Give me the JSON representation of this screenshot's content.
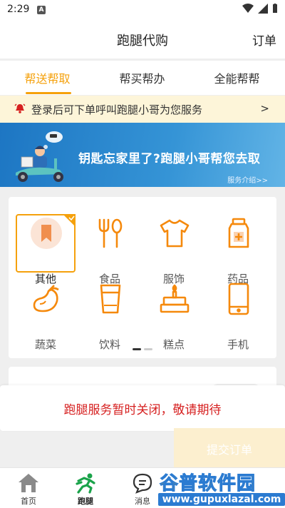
{
  "statusbar": {
    "time": "2:29",
    "notif_letter": "A"
  },
  "appbar": {
    "title": "跑腿代购",
    "orders_label": "订单"
  },
  "tabs": [
    {
      "label": "帮送帮取",
      "active": true
    },
    {
      "label": "帮买帮办",
      "active": false
    },
    {
      "label": "全能帮帮",
      "active": false
    }
  ],
  "notice": {
    "text": "登录后可下单呼叫跑腿小哥为您服务",
    "arrow": ">"
  },
  "banner": {
    "slogan": "钥匙忘家里了?跑腿小哥帮您去取",
    "intro_link": "服务介绍>>"
  },
  "categories": [
    {
      "label": "其他",
      "icon": "bookmark-icon",
      "selected": true
    },
    {
      "label": "食品",
      "icon": "fork-spoon-icon",
      "selected": false
    },
    {
      "label": "服饰",
      "icon": "tshirt-icon",
      "selected": false
    },
    {
      "label": "药品",
      "icon": "medicine-bottle-icon",
      "selected": false
    },
    {
      "label": "蔬菜",
      "icon": "eggplant-icon",
      "selected": false
    },
    {
      "label": "饮料",
      "icon": "cup-icon",
      "selected": false
    },
    {
      "label": "糕点",
      "icon": "cake-icon",
      "selected": false
    },
    {
      "label": "手机",
      "icon": "phone-icon",
      "selected": false
    }
  ],
  "pager": {
    "pages": 2,
    "current": 1
  },
  "closed_message": "跑腿服务暂时关闭，敬请期待",
  "submit_label": "提交订单",
  "bottom_nav": [
    {
      "label": "首页",
      "icon": "home-icon"
    },
    {
      "label": "跑腿",
      "icon": "runner-icon"
    },
    {
      "label": "消息",
      "icon": "message-icon"
    }
  ],
  "watermark": {
    "title": "谷普软件园",
    "url": "www.gupuxlazal.com"
  },
  "colors": {
    "accent": "#f5a10c",
    "alert": "#d62020",
    "banner": "#2a86cf"
  }
}
